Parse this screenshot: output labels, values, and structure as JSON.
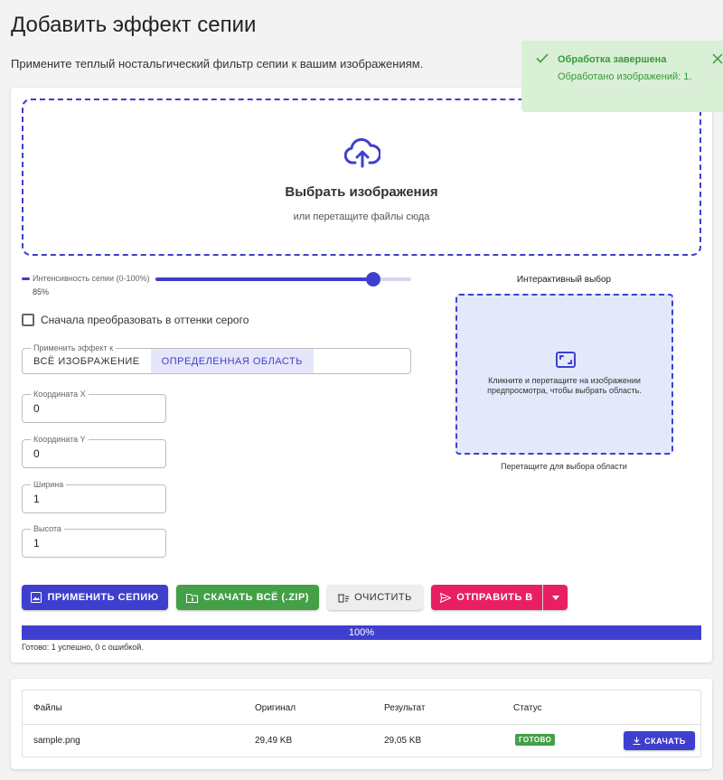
{
  "page": {
    "title": "Добавить эффект сепии",
    "subtitle": "Примените теплый ностальгический фильтр сепии к вашим изображениям."
  },
  "dropzone": {
    "title": "Выбрать изображения",
    "hint": "или перетащите файлы сюда",
    "icon": "cloud-upload-icon"
  },
  "intensity": {
    "label": "Интенсивность сепии (0-100%)",
    "value_text": "85%",
    "value": 85,
    "max": 100
  },
  "grayscale": {
    "label": "Сначала преобразовать в оттенки серого",
    "checked": false
  },
  "apply_to": {
    "legend": "Применить эффект к",
    "options": [
      "ВСЁ ИЗОБРАЖЕНИЕ",
      "ОПРЕДЕЛЕННАЯ ОБЛАСТЬ"
    ],
    "selected": "ОПРЕДЕЛЕННАЯ ОБЛАСТЬ"
  },
  "fields": {
    "x": {
      "label": "Координата X",
      "value": "0"
    },
    "y": {
      "label": "Координата Y",
      "value": "0"
    },
    "width": {
      "label": "Ширина",
      "value": "1"
    },
    "height": {
      "label": "Высота",
      "value": "1"
    }
  },
  "interactive": {
    "title": "Интерактивный выбор",
    "instruction": "Кликните и перетащите на изображении предпросмотра, чтобы выбрать область.",
    "caption": "Перетащите для выбора области"
  },
  "actions": {
    "apply": "ПРИМЕНИТЬ СЕПИЮ",
    "zip": "СКАЧАТЬ ВСЁ (.ZIP)",
    "clear": "ОЧИСТИТЬ",
    "send": "ОТПРАВИТЬ В"
  },
  "progress": {
    "percent_text": "100%",
    "percent": 100,
    "status": "Готово: 1 успешно, 0 с ошибкой."
  },
  "files_table": {
    "headers": [
      "Файлы",
      "Оригинал",
      "Результат",
      "Статус"
    ],
    "rows": [
      {
        "name": "sample.png",
        "original": "29,49 KB",
        "result": "29,05 KB",
        "status": "ГОТОВО",
        "action": "СКАЧАТЬ"
      }
    ]
  },
  "toast": {
    "title": "Обработка завершена",
    "message": "Обработано изображений: 1."
  },
  "colors": {
    "primary": "#3f3fcf",
    "success": "#43a047",
    "accent": "#e91e63",
    "toast_bg": "#d9efd6"
  }
}
